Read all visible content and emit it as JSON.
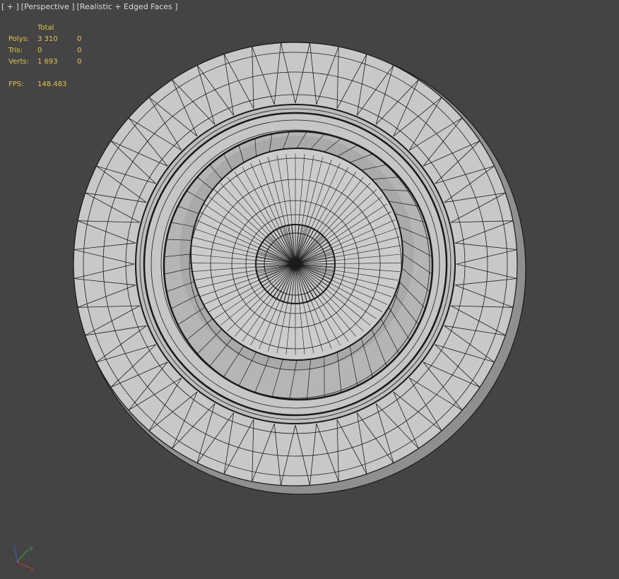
{
  "viewport_menu": {
    "plus": "[ + ]",
    "view": "[Perspective ]",
    "shading": "[Realistic + Edged Faces ]"
  },
  "stats": {
    "header": "Total",
    "rows": [
      {
        "label": "Polys:",
        "total": "3 310",
        "selected": "0"
      },
      {
        "label": "Tris:",
        "total": "0",
        "selected": "0"
      },
      {
        "label": "Verts:",
        "total": "1 693",
        "selected": "0"
      }
    ],
    "fps_label": "FPS:",
    "fps_value": "148.483"
  },
  "gizmo": {
    "x": "x",
    "y": "y",
    "z": "z"
  },
  "colors": {
    "background": "#444444",
    "stats_text": "#e6c44a",
    "mesh_face": "#c8c8c8",
    "wire": "#1a1a1a",
    "axis_x": "#c83a2a",
    "axis_y": "#3fa63f",
    "axis_z": "#3a5fd0"
  }
}
